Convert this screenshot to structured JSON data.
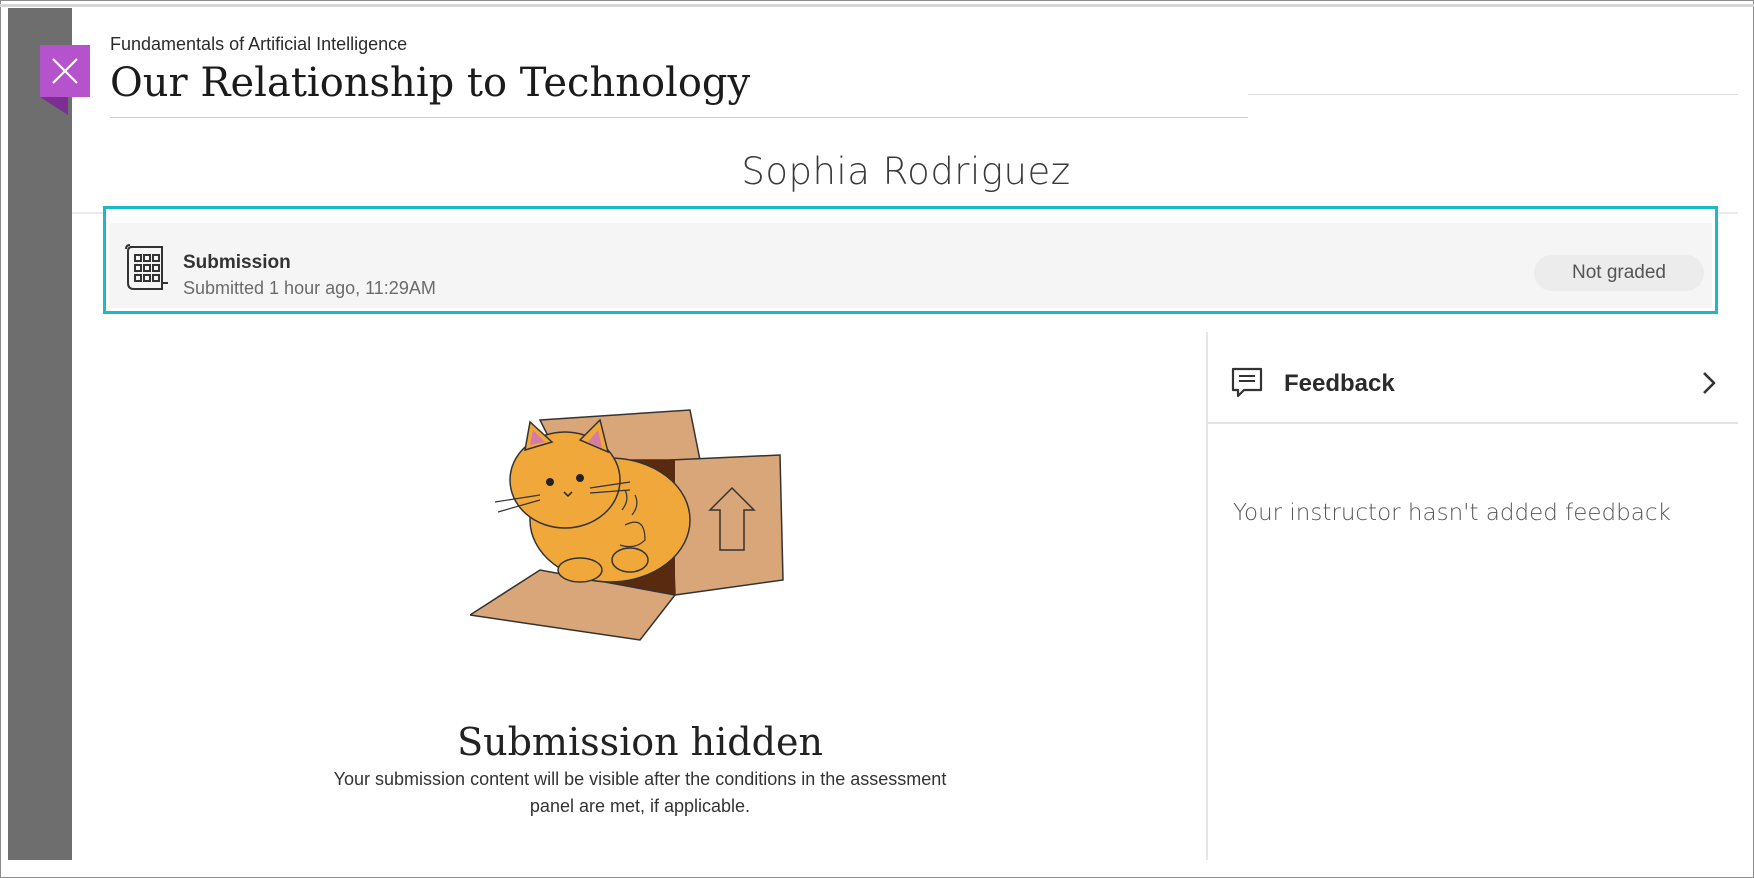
{
  "header": {
    "course_name": "Fundamentals of Artificial Intelligence",
    "page_title": "Our Relationship to Technology"
  },
  "student": {
    "name": "Sophia Rodriguez"
  },
  "submission": {
    "label": "Submission",
    "submitted_text": "Submitted 1 hour ago, 11:29AM",
    "grade_status": "Not graded",
    "icon": "document-grid-icon"
  },
  "feedback": {
    "heading": "Feedback",
    "empty_text": "Your instructor hasn't added feedback",
    "icon": "comment-icon"
  },
  "hidden": {
    "title": "Submission hidden",
    "description": "Your submission content will be visible after the conditions in the assessment panel are met, if applicable."
  },
  "colors": {
    "close_button": "#b453cc",
    "highlight_border": "#1fb8c8",
    "left_rail": "#6e6e6e"
  }
}
